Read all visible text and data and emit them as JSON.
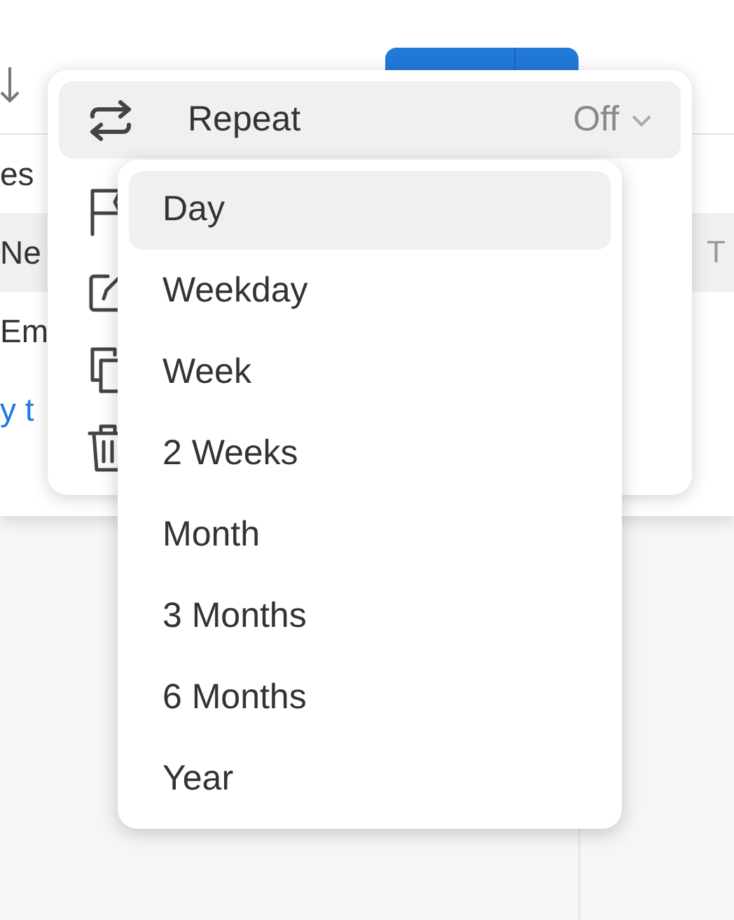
{
  "background": {
    "rows": [
      {
        "kind": "text",
        "text": "es",
        "selected": false
      },
      {
        "kind": "text",
        "text": "Ne",
        "trailing": "T",
        "selected": true
      },
      {
        "kind": "text",
        "text": "Em",
        "selected": false
      },
      {
        "kind": "link",
        "text": "y t",
        "selected": false
      }
    ]
  },
  "menu": {
    "repeat": {
      "label": "Repeat",
      "value": "Off",
      "selected": true
    }
  },
  "repeat_options": [
    {
      "label": "Day",
      "selected": true
    },
    {
      "label": "Weekday",
      "selected": false
    },
    {
      "label": "Week",
      "selected": false
    },
    {
      "label": "2 Weeks",
      "selected": false
    },
    {
      "label": "Month",
      "selected": false
    },
    {
      "label": "3 Months",
      "selected": false
    },
    {
      "label": "6 Months",
      "selected": false
    },
    {
      "label": "Year",
      "selected": false
    }
  ]
}
